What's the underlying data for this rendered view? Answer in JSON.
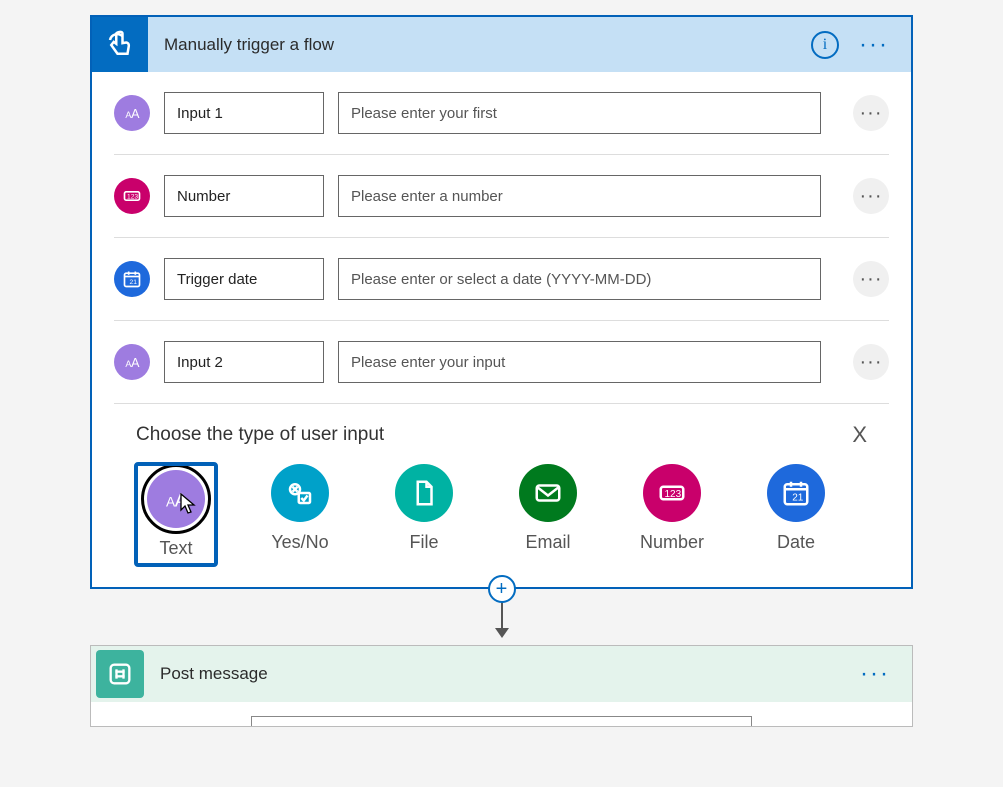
{
  "trigger": {
    "title": "Manually trigger a flow",
    "inputs": [
      {
        "icon": "text-icon",
        "color": "violet",
        "name": "Input 1",
        "placeholder": "Please enter your first"
      },
      {
        "icon": "number-icon",
        "color": "magenta",
        "name": "Number",
        "placeholder": "Please enter a number"
      },
      {
        "icon": "date-icon",
        "color": "blue",
        "name": "Trigger date",
        "placeholder": "Please enter or select a date (YYYY-MM-DD)"
      },
      {
        "icon": "text-icon",
        "color": "violet",
        "name": "Input 2",
        "placeholder": "Please enter your input"
      }
    ],
    "picker": {
      "label": "Choose the type of user input",
      "close": "X",
      "types": [
        {
          "label": "Text",
          "icon": "text-icon",
          "color": "c-violet",
          "selected": true
        },
        {
          "label": "Yes/No",
          "icon": "yesno-icon",
          "color": "c-cyan",
          "selected": false
        },
        {
          "label": "File",
          "icon": "file-icon",
          "color": "c-teal",
          "selected": false
        },
        {
          "label": "Email",
          "icon": "email-icon",
          "color": "c-green",
          "selected": false
        },
        {
          "label": "Number",
          "icon": "number-icon",
          "color": "c-magenta",
          "selected": false
        },
        {
          "label": "Date",
          "icon": "date-icon",
          "color": "c-blue",
          "selected": false
        }
      ]
    }
  },
  "action": {
    "title": "Post message"
  },
  "colors": {
    "accent": "#036cc1",
    "trigger_header_bg": "#c5e0f5",
    "action_header_bg": "#e4f3ec",
    "action_icon_bg": "#3db39e"
  }
}
